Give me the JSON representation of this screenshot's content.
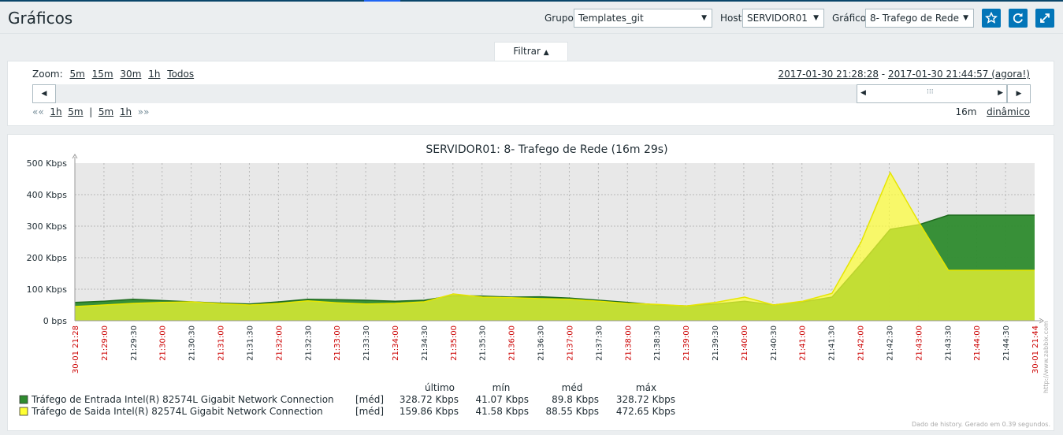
{
  "header": {
    "title": "Gráficos",
    "grupo_label": "Grupo",
    "grupo_value": "Templates_git",
    "host_label": "Host",
    "host_value": "SERVIDOR01",
    "grafico_label": "Gráfico",
    "grafico_value": "8- Trafego de Rede"
  },
  "filter": {
    "tab_label": "Filtrar",
    "zoom_label": "Zoom:",
    "zoom_options": [
      "5m",
      "15m",
      "30m",
      "1h",
      "Todos"
    ],
    "period_from": "2017-01-30 21:28:28",
    "period_sep": " - ",
    "period_to": "2017-01-30 21:44:57 (agora!)",
    "nav_back": [
      "««",
      "1h",
      "5m",
      "|",
      "5m",
      "1h",
      "»»"
    ],
    "period_length": "16m",
    "dynamic_label": "dinâmico"
  },
  "chart_data": {
    "type": "area",
    "title": "SERVIDOR01: 8- Trafego de Rede (16m 29s)",
    "ylabel": "",
    "y_ticks": [
      "500 Kbps",
      "400 Kbps",
      "300 Kbps",
      "200 Kbps",
      "100 Kbps",
      "0 bps"
    ],
    "ylim": [
      0,
      500
    ],
    "x_labels": [
      {
        "t": "30-01 21:28",
        "major": true
      },
      {
        "t": "21:29:00",
        "major": true
      },
      {
        "t": "21:29:30",
        "major": false
      },
      {
        "t": "21:30:00",
        "major": true
      },
      {
        "t": "21:30:30",
        "major": false
      },
      {
        "t": "21:31:00",
        "major": true
      },
      {
        "t": "21:31:30",
        "major": false
      },
      {
        "t": "21:32:00",
        "major": true
      },
      {
        "t": "21:32:30",
        "major": false
      },
      {
        "t": "21:33:00",
        "major": true
      },
      {
        "t": "21:33:30",
        "major": false
      },
      {
        "t": "21:34:00",
        "major": true
      },
      {
        "t": "21:34:30",
        "major": false
      },
      {
        "t": "21:35:00",
        "major": true
      },
      {
        "t": "21:35:30",
        "major": false
      },
      {
        "t": "21:36:00",
        "major": true
      },
      {
        "t": "21:36:30",
        "major": false
      },
      {
        "t": "21:37:00",
        "major": true
      },
      {
        "t": "21:37:30",
        "major": false
      },
      {
        "t": "21:38:00",
        "major": true
      },
      {
        "t": "21:38:30",
        "major": false
      },
      {
        "t": "21:39:00",
        "major": true
      },
      {
        "t": "21:39:30",
        "major": false
      },
      {
        "t": "21:40:00",
        "major": true
      },
      {
        "t": "21:40:30",
        "major": false
      },
      {
        "t": "21:41:00",
        "major": true
      },
      {
        "t": "21:41:30",
        "major": false
      },
      {
        "t": "21:42:00",
        "major": true
      },
      {
        "t": "21:42:30",
        "major": false
      },
      {
        "t": "21:43:00",
        "major": true
      },
      {
        "t": "21:43:30",
        "major": false
      },
      {
        "t": "21:44:00",
        "major": true
      },
      {
        "t": "21:44:30",
        "major": false
      },
      {
        "t": "30-01 21:44",
        "major": true
      }
    ],
    "series": [
      {
        "name": "Tráfego de Entrada Intel(R) 82574L Gigabit Network Connection",
        "color": "#2e8b2e",
        "x": [
          0,
          0.5,
          1.0,
          1.5,
          2.0,
          2.5,
          3.0,
          3.5,
          4.0,
          4.5,
          5.0,
          5.5,
          6.0,
          6.5,
          7.0,
          7.5,
          8.0,
          8.5,
          9.0,
          9.5,
          10.0,
          10.5,
          11.0,
          11.5,
          12.0,
          12.5,
          13.0,
          13.5,
          14.0,
          14.5,
          15.0,
          15.5,
          16.0,
          16.48
        ],
        "values": [
          58,
          62,
          68,
          64,
          60,
          56,
          53,
          60,
          68,
          67,
          65,
          62,
          65,
          80,
          78,
          75,
          76,
          72,
          65,
          58,
          50,
          47,
          53,
          62,
          50,
          60,
          75,
          180,
          290,
          305,
          335,
          335,
          335,
          335
        ]
      },
      {
        "name": "Tráfego de Saida Intel(R) 82574L Gigabit Network Connection",
        "color": "#ffff33",
        "x": [
          0,
          0.5,
          1.0,
          1.5,
          2.0,
          2.5,
          3.0,
          3.5,
          4.0,
          4.5,
          5.0,
          5.5,
          6.0,
          6.5,
          7.0,
          7.5,
          8.0,
          8.5,
          9.0,
          9.5,
          10.0,
          10.5,
          11.0,
          11.5,
          12.0,
          12.5,
          13.0,
          13.5,
          14.0,
          14.5,
          15.0,
          15.5,
          16.0,
          16.48
        ],
        "values": [
          45,
          50,
          55,
          58,
          60,
          54,
          50,
          55,
          63,
          57,
          53,
          55,
          60,
          85,
          75,
          73,
          70,
          68,
          62,
          55,
          52,
          47,
          58,
          75,
          50,
          62,
          87,
          250,
          470,
          310,
          160,
          160,
          160,
          160
        ]
      }
    ],
    "legend": {
      "headers": [
        "último",
        "mín",
        "méd",
        "máx"
      ],
      "rows": [
        {
          "color": "#2e8b2e",
          "name": "Tráfego de Entrada Intel(R) 82574L Gigabit Network Connection",
          "type": "[méd]",
          "last": "328.72 Kbps",
          "min": "41.07 Kbps",
          "avg": "89.8 Kbps",
          "max": "328.72 Kbps"
        },
        {
          "color": "#ffff33",
          "name": "Tráfego de Saida Intel(R) 82574L Gigabit Network Connection",
          "type": "[méd]",
          "last": "159.86 Kbps",
          "min": "41.58 Kbps",
          "avg": "88.55 Kbps",
          "max": "472.65 Kbps"
        }
      ]
    },
    "watermark": "http://www.zabbix.com",
    "footer_note": "Dado de history. Gerado em 0.39 segundos."
  }
}
